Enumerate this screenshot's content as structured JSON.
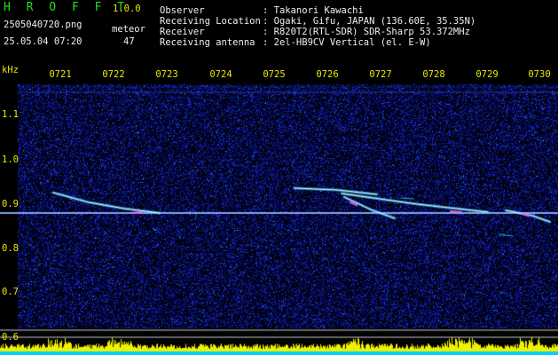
{
  "header": {
    "app_name": "H R O F F T",
    "version": "1.0.0",
    "filename": "2505040720.png",
    "datetime": "25.05.04 07:20",
    "meteor_label": "meteor",
    "meteor_count": "47"
  },
  "station": {
    "rows": [
      {
        "label": "Observer",
        "value": ": Takanori Kawachi"
      },
      {
        "label": "Receiving Location",
        "value": ": Ogaki, Gifu, JAPAN (136.60E, 35.35N)"
      },
      {
        "label": "Receiver",
        "value": ": R820T2(RTL-SDR) SDR-Sharp 53.372MHz"
      },
      {
        "label": "Receiving antenna",
        "value": ": 2el-HB9CV Vertical (el. E-W)"
      }
    ]
  },
  "time_axis": {
    "ticks": [
      "0721",
      "0722",
      "0723",
      "0724",
      "0725",
      "0726",
      "0727",
      "0728",
      "0729",
      "0730"
    ]
  },
  "freq_axis": {
    "unit": "kHz",
    "ticks": [
      "1.1",
      "1.0",
      "0.9",
      "0.8",
      "0.7",
      "0.6"
    ]
  },
  "colors": {
    "background": "#000000",
    "noise_dark": "#050a6e",
    "noise_bright": "#2a4aff",
    "carrier": "#7aa0ff",
    "echo_core": "#ffffff",
    "echo_glow": "#30e0ff",
    "echo_hot": "#ff60ff",
    "power_bar": "#f0f000",
    "power_base": "#00d0ff",
    "label_yellow": "#e8e800",
    "label_white": "#f0f0f0",
    "title_green": "#22dd22"
  }
}
